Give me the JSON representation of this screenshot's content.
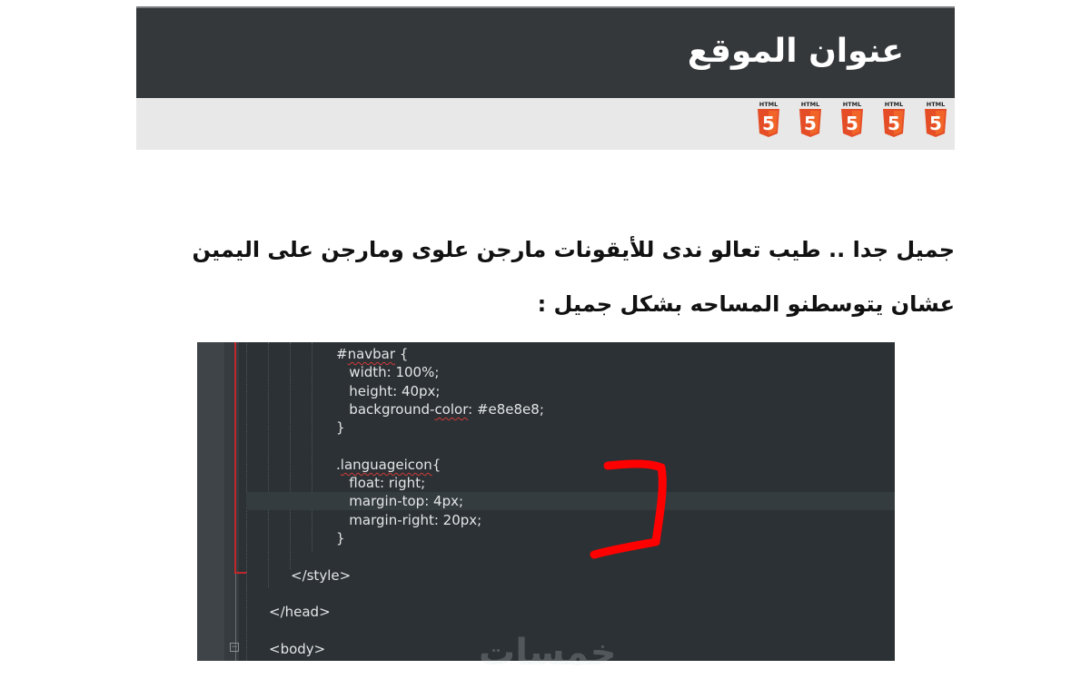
{
  "site_mock": {
    "title": "عنوان الموقع",
    "nav_background": "#e8e8e8",
    "header_background": "#35383b",
    "language_icons": [
      {
        "label": "HTML",
        "glyph": "5",
        "icon": "html5-icon",
        "color": "#e44d26"
      },
      {
        "label": "HTML",
        "glyph": "5",
        "icon": "html5-icon",
        "color": "#e44d26"
      },
      {
        "label": "HTML",
        "glyph": "5",
        "icon": "html5-icon",
        "color": "#e44d26"
      },
      {
        "label": "HTML",
        "glyph": "5",
        "icon": "html5-icon",
        "color": "#e44d26"
      },
      {
        "label": "HTML",
        "glyph": "5",
        "icon": "html5-icon",
        "color": "#e44d26"
      }
    ]
  },
  "article": {
    "lines": [
      "جميل جدا .. طيب تعالو ندى للأيقونات مارجن علوى ومارجن على اليمين",
      "عشان يتوسطنو المساحه بشكل جميل :"
    ]
  },
  "code_editor": {
    "background": "#2b3134",
    "annotation_color": "#ff0000",
    "lines": [
      {
        "text": "#navbar {",
        "squiggle": "navbar"
      },
      {
        "text": "   width: 100%;"
      },
      {
        "text": "   height: 40px;"
      },
      {
        "text": "   background-color: #e8e8e8;",
        "squiggle": "color"
      },
      {
        "text": "}"
      },
      {
        "text": ""
      },
      {
        "text": ".languageicon{",
        "squiggle": "languageicon"
      },
      {
        "text": "   float: right;"
      },
      {
        "text": "   margin-top: 4px;"
      },
      {
        "text": "   margin-right: 20px;"
      },
      {
        "text": "}"
      },
      {
        "text": ""
      },
      {
        "text": "</style>"
      },
      {
        "text": ""
      },
      {
        "text": "</head>"
      },
      {
        "text": ""
      },
      {
        "text": "<body>"
      }
    ]
  },
  "watermark": "خمسات"
}
